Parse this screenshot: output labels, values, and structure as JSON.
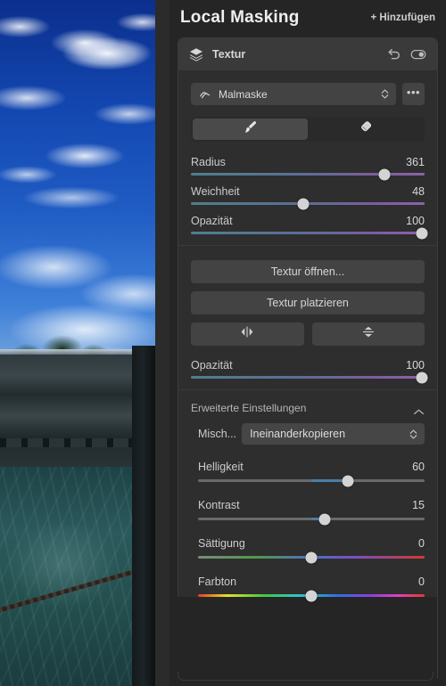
{
  "header": {
    "title": "Local Masking",
    "add_label": "+ Hinzufügen"
  },
  "layer": {
    "name": "Textur",
    "icon": "layers-icon",
    "reset_icon": "undo-icon",
    "visibility_icon": "toggle-on-icon"
  },
  "mask": {
    "select_label": "Malmaske",
    "select_icon": "paint-mask-icon",
    "more_label": "•••",
    "tools": [
      {
        "name": "brush",
        "icon": "brush-icon",
        "active": true
      },
      {
        "name": "eraser",
        "icon": "eraser-icon",
        "active": false
      }
    ],
    "sliders": [
      {
        "label": "Radius",
        "value": "361",
        "pos": 83,
        "style": "gradient"
      },
      {
        "label": "Weichheit",
        "value": "48",
        "pos": 48,
        "style": "gradient"
      },
      {
        "label": "Opazität",
        "value": "100",
        "pos": 100,
        "style": "gradient"
      }
    ]
  },
  "texture": {
    "open_label": "Textur öffnen...",
    "place_label": "Textur platzieren",
    "flip_horizontal_icon": "flip-horizontal-icon",
    "flip_vertical_icon": "flip-vertical-icon",
    "opacity": {
      "label": "Opazität",
      "value": "100",
      "pos": 100,
      "style": "gradient"
    }
  },
  "advanced": {
    "title": "Erweiterte Einstellungen",
    "collapse_icon": "chevron-up-icon",
    "blend": {
      "label": "Misch...",
      "value": "Ineinanderkopieren"
    },
    "sliders": [
      {
        "label": "Helligkeit",
        "value": "60",
        "pos": 66,
        "style": "plain",
        "fill_from": 50
      },
      {
        "label": "Kontrast",
        "value": "15",
        "pos": 56,
        "style": "plain",
        "fill_from": 50
      },
      {
        "label": "Sättigung",
        "value": "0",
        "pos": 50,
        "style": "saturation"
      },
      {
        "label": "Farbton",
        "value": "0",
        "pos": 50,
        "style": "hue"
      }
    ]
  },
  "colors": {
    "panel_bg": "#252525",
    "card_bg": "#2e2e2e",
    "control_bg": "#434343",
    "text": "#d6d6d6",
    "accent_blue": "#4a7ea8"
  }
}
